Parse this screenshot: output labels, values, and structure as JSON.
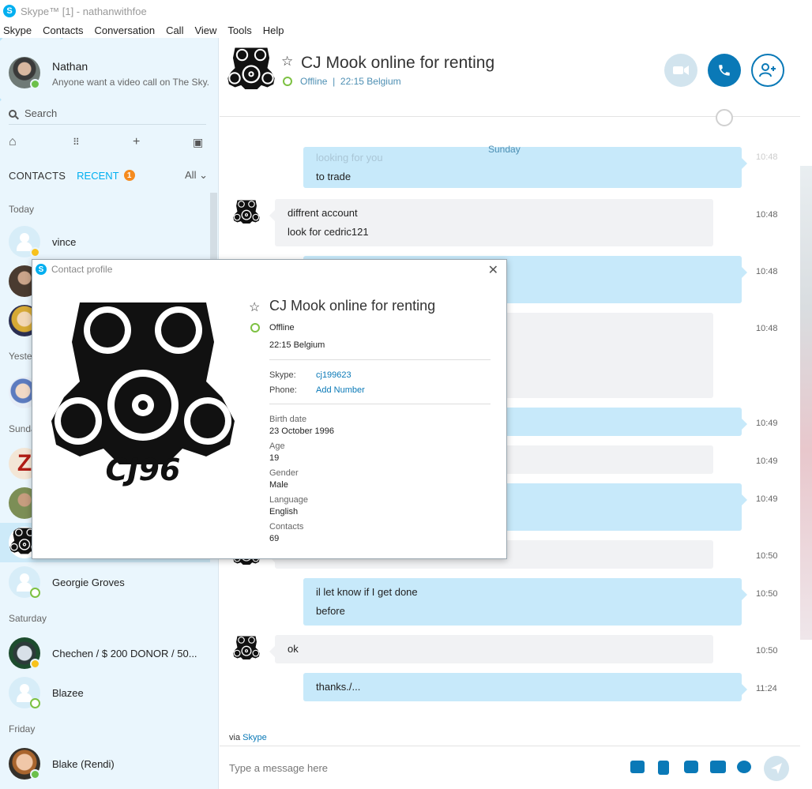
{
  "window": {
    "title": "Skype™ [1] - nathanwithfoe"
  },
  "menu": [
    "Skype",
    "Contacts",
    "Conversation",
    "Call",
    "View",
    "Tools",
    "Help"
  ],
  "me": {
    "name": "Nathan",
    "mood": "Anyone want a video call on The Sky..."
  },
  "search": {
    "label": "Search"
  },
  "tabs": {
    "contacts": "CONTACTS",
    "recent": "RECENT",
    "recent_badge": "1",
    "filter": "All"
  },
  "sections": {
    "today": "Today",
    "yesterday": "Yester",
    "sunday": "Sunda",
    "saturday": "Saturday",
    "friday": "Friday"
  },
  "contacts": {
    "vince": "vince",
    "georgie": "Georgie Groves",
    "chechen": "Chechen / $ 200 DONOR / 50...",
    "blazee": "Blazee",
    "blake": "Blake (Rendi)"
  },
  "conversation": {
    "title": "CJ Mook online for renting",
    "status": "Offline",
    "local_time": "22:15 Belgium",
    "status_line": "Offline  |  22:15 Belgium",
    "day_label": "Sunday"
  },
  "messages": [
    {
      "dir": "out",
      "lines": [
        "looking for you",
        "to trade"
      ],
      "time": "10:48"
    },
    {
      "dir": "in",
      "lines": [
        "diffrent account",
        "look for cedric121"
      ],
      "time": "10:48"
    },
    {
      "dir": "out",
      "lines": [],
      "time": "10:48"
    },
    {
      "dir": "in",
      "lines": [],
      "time": "10:48"
    },
    {
      "dir": "out",
      "lines": [],
      "time": "10:49"
    },
    {
      "dir": "in",
      "lines": [],
      "time": "10:49"
    },
    {
      "dir": "out",
      "lines": [],
      "time": "10:49"
    },
    {
      "dir": "in",
      "lines": [],
      "time": "10:50"
    },
    {
      "dir": "out",
      "lines": [
        "il let know if I get done",
        "before"
      ],
      "time": "10:50"
    },
    {
      "dir": "in",
      "lines": [
        "ok"
      ],
      "time": "10:50"
    },
    {
      "dir": "out",
      "lines": [
        "thanks./..."
      ],
      "time": "11:24"
    }
  ],
  "footer": {
    "via": "via",
    "via_link": "Skype",
    "placeholder": "Type a message here"
  },
  "profile": {
    "window_title": "Contact profile",
    "name": "CJ Mook online for renting",
    "status": "Offline",
    "local_time": "22:15 Belgium",
    "skype_label": "Skype:",
    "skype_value": "cj199623",
    "phone_label": "Phone:",
    "phone_value": "Add Number",
    "birth_label": "Birth date",
    "birth_value": "23 October 1996",
    "age_label": "Age",
    "age_value": "19",
    "gender_label": "Gender",
    "gender_value": "Male",
    "language_label": "Language",
    "language_value": "English",
    "contacts_label": "Contacts",
    "contacts_value": "69",
    "mask_text": "CJ96"
  },
  "colors": {
    "accent": "#00aff0",
    "call_blue": "#0a79b7",
    "bubble_out": "#c7e9fa",
    "bubble_in": "#f1f2f4",
    "online": "#6cc04a",
    "away": "#f8c21c"
  }
}
